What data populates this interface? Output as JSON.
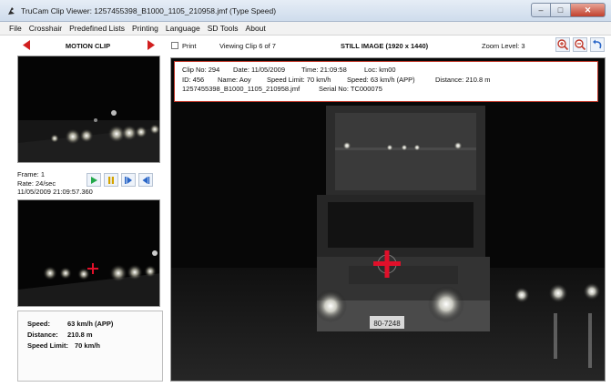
{
  "window": {
    "title": "TruCam Clip Viewer:  1257455398_B1000_1105_210958.jmf  (Type Speed)",
    "icon": "app-icon",
    "controls": [
      "minimize-icon",
      "maximize-icon",
      "close-icon"
    ]
  },
  "menu": [
    "File",
    "Crosshair",
    "Predefined Lists",
    "Printing",
    "Language",
    "SD Tools",
    "About"
  ],
  "motion_clip": {
    "title": "MOTION CLIP",
    "frame": "Frame: 1",
    "rate": "Rate: 24/sec",
    "timestamp": "11/05/2009 21:09:57.360",
    "controls": [
      "play-icon",
      "pause-icon",
      "step-forward-icon",
      "rewind-icon"
    ]
  },
  "stats": {
    "speed_label": "Speed:",
    "speed_value": "63 km/h (APP)",
    "distance_label": "Distance:",
    "distance_value": "210.8 m",
    "limit_label": "Speed Limit:",
    "limit_value": "70 km/h"
  },
  "toolbar": {
    "print_label": "Print",
    "viewing": "Viewing Clip 6 of 7",
    "still_image": "STILL IMAGE (1920 x 1440)",
    "zoom": "Zoom Level:  3",
    "buttons": [
      "zoom-in-icon",
      "zoom-out-icon",
      "undo-icon"
    ]
  },
  "clip_info": {
    "clip_no": "Clip No: 294",
    "date": "Date: 11/05/2009",
    "time": "Time: 21:09:58",
    "loc": "Loc: km00",
    "id": "ID: 456",
    "name": "Name: Aoy",
    "speed_limit": "Speed Limit: 70 km/h",
    "speed": "Speed: 63 km/h (APP)",
    "distance": "Distance: 210.8 m",
    "filename": "1257455398_B1000_1105_210958.jmf",
    "serial": "Serial No: TC000075"
  },
  "plate_text": "80-7248",
  "colors": {
    "accent_red": "#c0392b",
    "play_green": "#23a84a",
    "pause_yellow": "#d4a300",
    "nav_blue": "#2a66c7",
    "crosshair": "#e0102a"
  }
}
